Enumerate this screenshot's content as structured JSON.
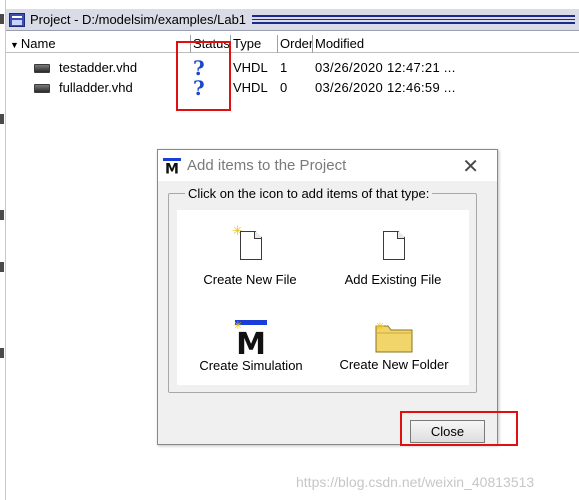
{
  "project_window": {
    "title": "Project - D:/modelsim/examples/Lab1",
    "columns": [
      "Name",
      "Status",
      "Type",
      "Order",
      "Modified"
    ],
    "files": [
      {
        "name": "testadder.vhd",
        "status": "?",
        "type": "VHDL",
        "order": "1",
        "modified": "03/26/2020 12:47:21 ..."
      },
      {
        "name": "fulladder.vhd",
        "status": "?",
        "type": "VHDL",
        "order": "0",
        "modified": "03/26/2020 12:46:59 ..."
      }
    ]
  },
  "dialog": {
    "title": "Add items to the Project",
    "close_glyph": "✕",
    "group_label": "Click on the icon to add items of that type:",
    "items": {
      "create_new_file": "Create New File",
      "add_existing_file": "Add Existing File",
      "create_simulation": "Create Simulation",
      "create_new_folder": "Create New Folder"
    },
    "close_button": "Close"
  },
  "watermark": "https://blog.csdn.net/weixin_40813513",
  "colors": {
    "highlight": "#e01010",
    "status_icon": "#1c47c9",
    "folder": "#f2d56a"
  }
}
